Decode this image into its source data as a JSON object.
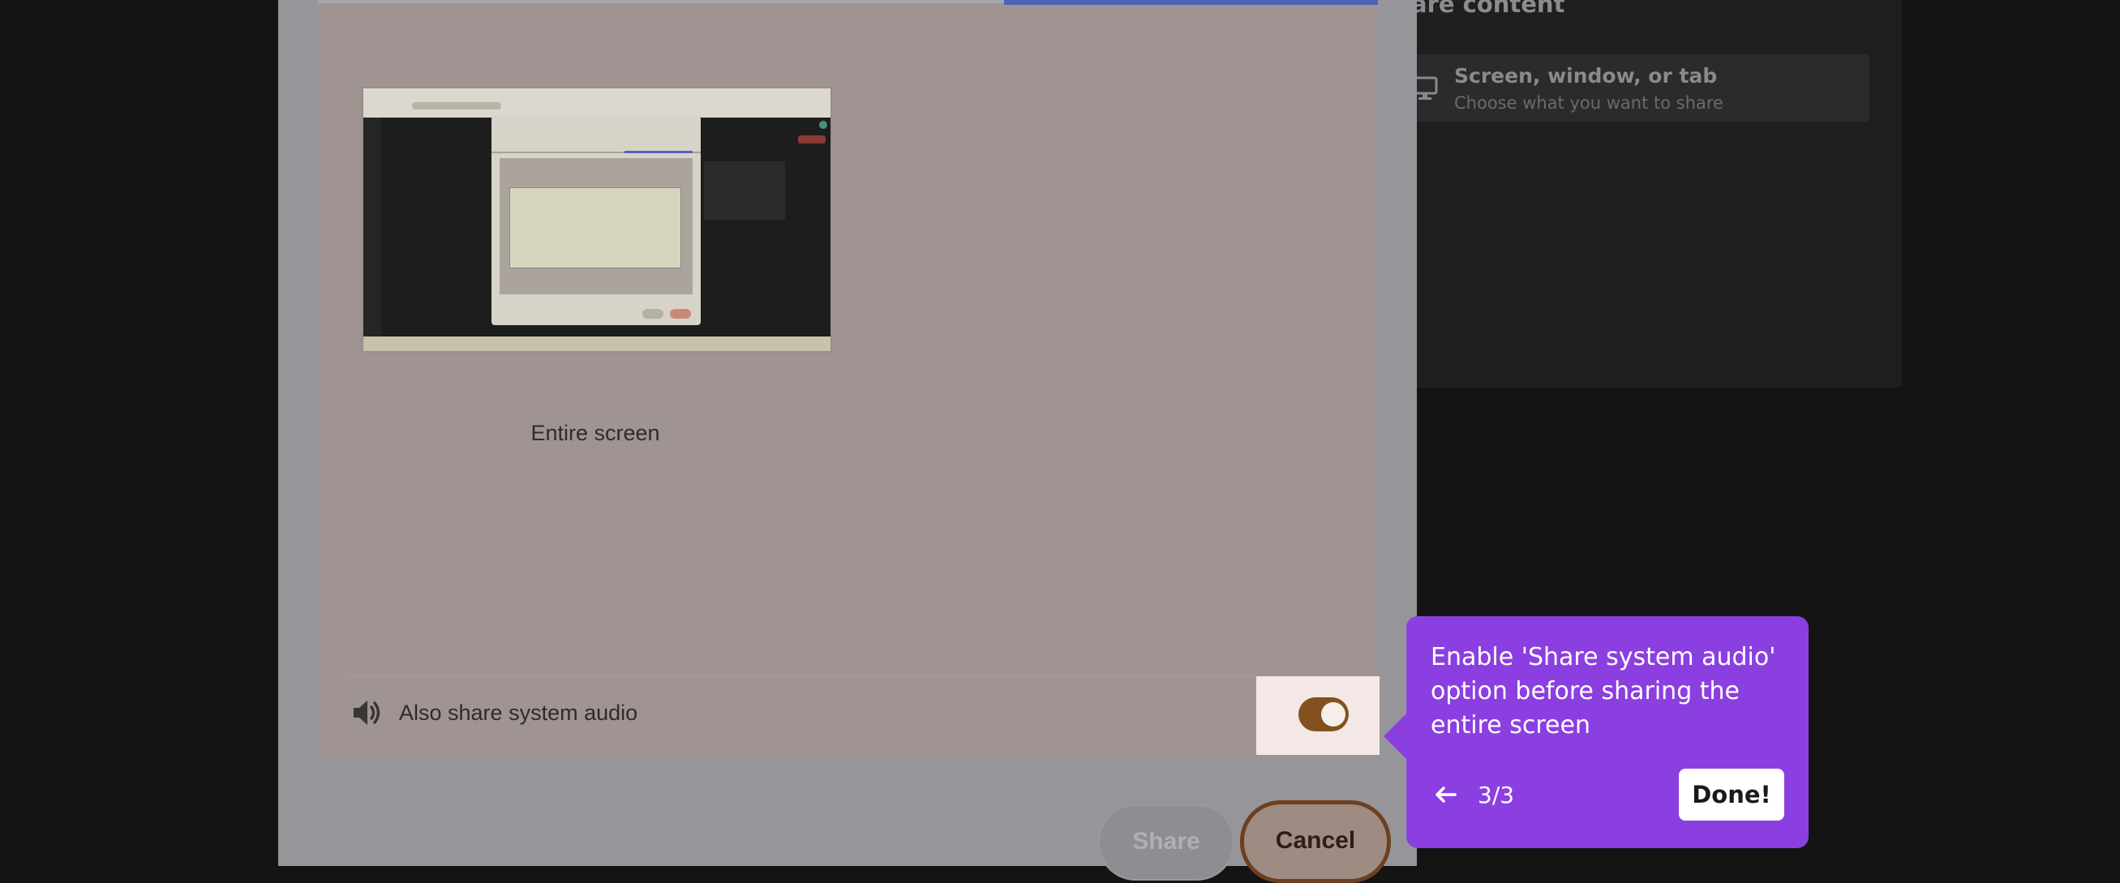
{
  "share_panel": {
    "heading": "are content",
    "option_title": "Screen, window, or tab",
    "option_subtitle": "Choose what you want to share",
    "option_icon": "monitor-icon"
  },
  "dialog": {
    "thumbnail_label": "Entire screen",
    "audio_label": "Also share system audio",
    "audio_icon": "speaker-icon",
    "audio_toggle_on": true,
    "share_button": "Share",
    "cancel_button": "Cancel"
  },
  "tooltip": {
    "message": "Enable 'Share system audio' option before sharing the entire screen",
    "step": "3/3",
    "done_button": "Done!",
    "back_icon": "arrow-left-icon"
  },
  "colors": {
    "tooltip_bg": "#8c3fe0",
    "toggle_on": "#83501f",
    "active_tab": "#4d63b8"
  }
}
